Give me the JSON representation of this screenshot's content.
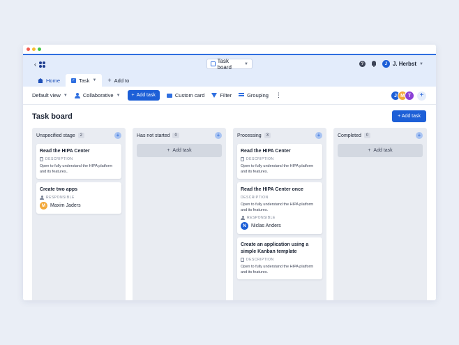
{
  "header": {
    "board_selector": "Task board",
    "user_initial": "J",
    "user_name": "J. Herbst"
  },
  "tabs": [
    {
      "label": "Home"
    },
    {
      "label": "Task"
    },
    {
      "label": "Add to"
    }
  ],
  "toolbar": {
    "view": "Default view",
    "collaborative": "Collaborative",
    "add_task": "Add task",
    "custom_card": "Custom card",
    "filter": "Filter",
    "grouping": "Grouping",
    "avatars": [
      {
        "initial": "J",
        "color": "#1d5fd7"
      },
      {
        "initial": "M",
        "color": "#f3a93a"
      },
      {
        "initial": "T",
        "color": "#8a3fd6"
      }
    ]
  },
  "board": {
    "title": "Task board",
    "add_task": "+ Add task"
  },
  "labels": {
    "description": "DESCRIPTION",
    "responsible": "RESPONSIBLE",
    "add_task": "Add task"
  },
  "columns": [
    {
      "name": "Unspecified stage",
      "count": "2",
      "cards": [
        {
          "title": "Read the HIPA Center",
          "description": "Open to fully understand the HIPA platform and its features.."
        },
        {
          "title": "Create two apps",
          "responsible": "Maxim Jaders",
          "responsible_initial": "M",
          "responsible_color": "#f3a93a"
        }
      ]
    },
    {
      "name": "Has not started",
      "count": "0"
    },
    {
      "name": "Processing",
      "count": "3",
      "cards": [
        {
          "title": "Read the HIPA Center",
          "description": "Open to fully understand the HIPA platform and its features."
        },
        {
          "title": "Read the HIPA Center once",
          "description": "Open to fully understand the HIPA platform and its features.",
          "responsible": "Niclas Anders",
          "responsible_initial": "N",
          "responsible_color": "#1d5fd7"
        },
        {
          "title": "Create an application using a simple Kanban template",
          "description": "Open to fully understand the HIPA platform and its features."
        }
      ]
    },
    {
      "name": "Completed",
      "count": "0"
    }
  ]
}
